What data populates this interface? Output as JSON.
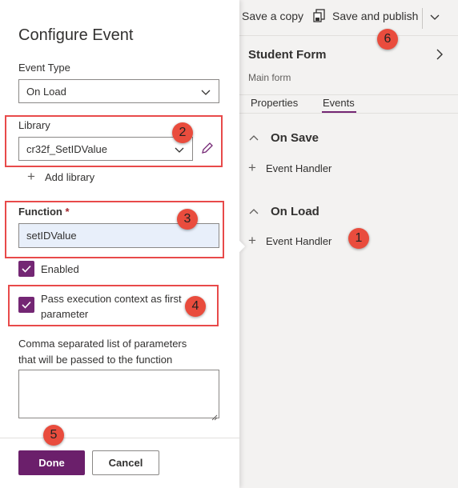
{
  "toolbar": {
    "save_copy": "Save a copy",
    "save_publish": "Save and publish"
  },
  "form_pane": {
    "title": "Student Form",
    "subtitle": "Main form",
    "tabs": [
      {
        "label": "Properties",
        "active": false
      },
      {
        "label": "Events",
        "active": true
      }
    ],
    "sections": [
      {
        "label": "On Save",
        "handler_label": "Event Handler"
      },
      {
        "label": "On Load",
        "handler_label": "Event Handler"
      }
    ]
  },
  "panel": {
    "title": "Configure Event",
    "event_type_label": "Event Type",
    "event_type_value": "On Load",
    "library_label": "Library",
    "library_value": "cr32f_SetIDValue",
    "add_library_label": "Add library",
    "function_label": "Function",
    "required_mark": "*",
    "function_value": "setIDValue",
    "enabled_label": "Enabled",
    "enabled_checked": true,
    "pass_context_label_line1": "Pass execution context as first",
    "pass_context_label_line2": "parameter",
    "pass_context_checked": true,
    "params_label_line1": "Comma separated list of parameters",
    "params_label_line2": "that will be passed to the function",
    "params_value": "",
    "done_label": "Done",
    "cancel_label": "Cancel"
  },
  "annotations": {
    "badges": [
      "1",
      "2",
      "3",
      "4",
      "5",
      "6"
    ]
  },
  "colors": {
    "accent": "#742774",
    "highlight": "#e84a4a",
    "badge": "#e94c3d",
    "input_fill": "#e8effa"
  },
  "icons": [
    "save-publish-icon",
    "chevron-down-icon",
    "chevron-right-icon",
    "chevron-up-icon",
    "plus-icon",
    "edit-icon",
    "checkmark-icon"
  ]
}
